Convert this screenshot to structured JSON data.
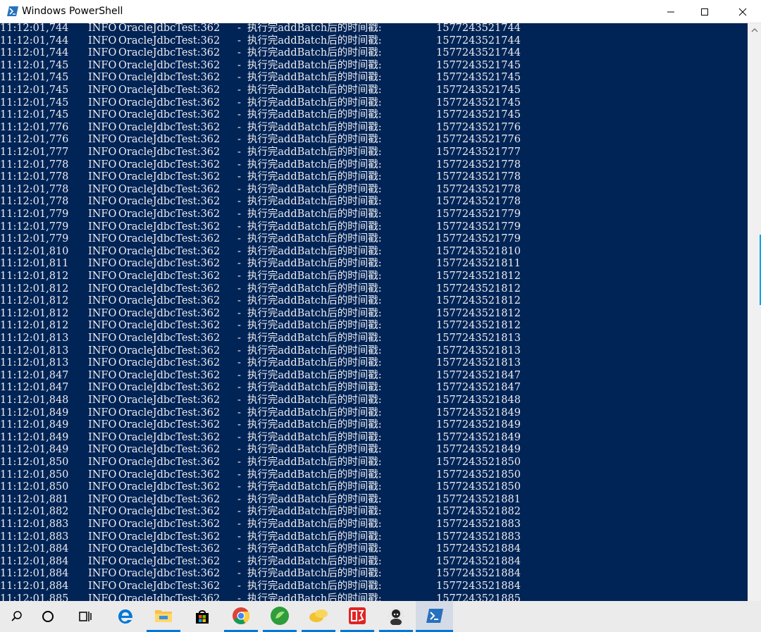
{
  "window": {
    "title": "Windows PowerShell"
  },
  "console": {
    "log_level": "INFO",
    "logger": "OracleJdbcTest:362",
    "separator": "-",
    "message": "执行完addBatch后的时间戳:",
    "lines": [
      {
        "time": "11:12:01,744",
        "ts": "1577243521744"
      },
      {
        "time": "11:12:01,744",
        "ts": "1577243521744"
      },
      {
        "time": "11:12:01,744",
        "ts": "1577243521744"
      },
      {
        "time": "11:12:01,745",
        "ts": "1577243521745"
      },
      {
        "time": "11:12:01,745",
        "ts": "1577243521745"
      },
      {
        "time": "11:12:01,745",
        "ts": "1577243521745"
      },
      {
        "time": "11:12:01,745",
        "ts": "1577243521745"
      },
      {
        "time": "11:12:01,745",
        "ts": "1577243521745"
      },
      {
        "time": "11:12:01,776",
        "ts": "1577243521776"
      },
      {
        "time": "11:12:01,776",
        "ts": "1577243521776"
      },
      {
        "time": "11:12:01,777",
        "ts": "1577243521777"
      },
      {
        "time": "11:12:01,778",
        "ts": "1577243521778"
      },
      {
        "time": "11:12:01,778",
        "ts": "1577243521778"
      },
      {
        "time": "11:12:01,778",
        "ts": "1577243521778"
      },
      {
        "time": "11:12:01,778",
        "ts": "1577243521778"
      },
      {
        "time": "11:12:01,779",
        "ts": "1577243521779"
      },
      {
        "time": "11:12:01,779",
        "ts": "1577243521779"
      },
      {
        "time": "11:12:01,779",
        "ts": "1577243521779"
      },
      {
        "time": "11:12:01,810",
        "ts": "1577243521810"
      },
      {
        "time": "11:12:01,811",
        "ts": "1577243521811"
      },
      {
        "time": "11:12:01,812",
        "ts": "1577243521812"
      },
      {
        "time": "11:12:01,812",
        "ts": "1577243521812"
      },
      {
        "time": "11:12:01,812",
        "ts": "1577243521812"
      },
      {
        "time": "11:12:01,812",
        "ts": "1577243521812"
      },
      {
        "time": "11:12:01,812",
        "ts": "1577243521812"
      },
      {
        "time": "11:12:01,813",
        "ts": "1577243521813"
      },
      {
        "time": "11:12:01,813",
        "ts": "1577243521813"
      },
      {
        "time": "11:12:01,813",
        "ts": "1577243521813"
      },
      {
        "time": "11:12:01,847",
        "ts": "1577243521847"
      },
      {
        "time": "11:12:01,847",
        "ts": "1577243521847"
      },
      {
        "time": "11:12:01,848",
        "ts": "1577243521848"
      },
      {
        "time": "11:12:01,849",
        "ts": "1577243521849"
      },
      {
        "time": "11:12:01,849",
        "ts": "1577243521849"
      },
      {
        "time": "11:12:01,849",
        "ts": "1577243521849"
      },
      {
        "time": "11:12:01,849",
        "ts": "1577243521849"
      },
      {
        "time": "11:12:01,850",
        "ts": "1577243521850"
      },
      {
        "time": "11:12:01,850",
        "ts": "1577243521850"
      },
      {
        "time": "11:12:01,850",
        "ts": "1577243521850"
      },
      {
        "time": "11:12:01,881",
        "ts": "1577243521881"
      },
      {
        "time": "11:12:01,882",
        "ts": "1577243521882"
      },
      {
        "time": "11:12:01,883",
        "ts": "1577243521883"
      },
      {
        "time": "11:12:01,883",
        "ts": "1577243521883"
      },
      {
        "time": "11:12:01,884",
        "ts": "1577243521884"
      },
      {
        "time": "11:12:01,884",
        "ts": "1577243521884"
      },
      {
        "time": "11:12:01,884",
        "ts": "1577243521884"
      },
      {
        "time": "11:12:01,884",
        "ts": "1577243521884"
      },
      {
        "time": "11:12:01,885",
        "ts": "1577243521885"
      }
    ]
  },
  "taskbar": {
    "items": [
      {
        "name": "search-icon",
        "state": "normal"
      },
      {
        "name": "cortana-icon",
        "state": "normal"
      },
      {
        "name": "task-view-icon",
        "state": "normal"
      },
      {
        "name": "edge-icon",
        "state": "normal"
      },
      {
        "name": "file-explorer-icon",
        "state": "running"
      },
      {
        "name": "store-icon",
        "state": "normal"
      },
      {
        "name": "chrome-icon",
        "state": "running"
      },
      {
        "name": "green-app-icon",
        "state": "running"
      },
      {
        "name": "yellow-app-icon",
        "state": "running"
      },
      {
        "name": "red-app-icon",
        "state": "running"
      },
      {
        "name": "avatar-app-icon",
        "state": "running"
      },
      {
        "name": "powershell-icon",
        "state": "active"
      }
    ]
  },
  "colors": {
    "console_bg": "#012456",
    "console_fg": "#eeedf0",
    "accent": "#0078d7"
  }
}
